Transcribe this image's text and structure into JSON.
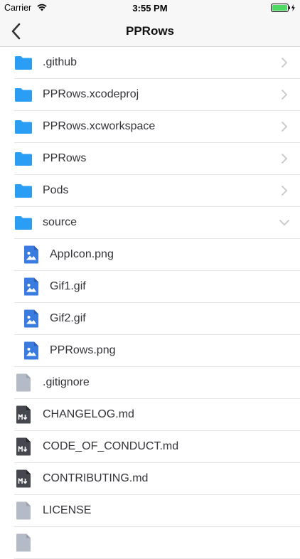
{
  "status_bar": {
    "carrier": "Carrier",
    "time": "3:55 PM",
    "wifi_icon": "wifi-icon",
    "battery_icon": "battery-charging-icon"
  },
  "nav": {
    "back_icon": "chevron-left-icon",
    "title": "PPRows"
  },
  "colors": {
    "folder": "#2a9df4",
    "image_file": "#3a7be0",
    "generic_file": "#b4bac6",
    "markdown_file": "#44474d",
    "chevron": "#c7c7cc"
  },
  "files": [
    {
      "name": ".github",
      "kind": "folder",
      "level": 0,
      "chevron": "right"
    },
    {
      "name": "PPRows.xcodeproj",
      "kind": "folder",
      "level": 0,
      "chevron": "right"
    },
    {
      "name": "PPRows.xcworkspace",
      "kind": "folder",
      "level": 0,
      "chevron": "right"
    },
    {
      "name": "PPRows",
      "kind": "folder",
      "level": 0,
      "chevron": "right"
    },
    {
      "name": "Pods",
      "kind": "folder",
      "level": 0,
      "chevron": "right"
    },
    {
      "name": "source",
      "kind": "folder",
      "level": 0,
      "chevron": "down"
    },
    {
      "name": "AppIcon.png",
      "kind": "image",
      "level": 1,
      "chevron": ""
    },
    {
      "name": "Gif1.gif",
      "kind": "image",
      "level": 1,
      "chevron": ""
    },
    {
      "name": "Gif2.gif",
      "kind": "image",
      "level": 1,
      "chevron": ""
    },
    {
      "name": "PPRows.png",
      "kind": "image",
      "level": 1,
      "chevron": ""
    },
    {
      "name": ".gitignore",
      "kind": "file",
      "level": 0,
      "chevron": ""
    },
    {
      "name": "CHANGELOG.md",
      "kind": "markdown",
      "level": 0,
      "chevron": ""
    },
    {
      "name": "CODE_OF_CONDUCT.md",
      "kind": "markdown",
      "level": 0,
      "chevron": ""
    },
    {
      "name": "CONTRIBUTING.md",
      "kind": "markdown",
      "level": 0,
      "chevron": ""
    },
    {
      "name": "LICENSE",
      "kind": "file",
      "level": 0,
      "chevron": ""
    },
    {
      "name": "",
      "kind": "file",
      "level": 0,
      "chevron": ""
    }
  ]
}
